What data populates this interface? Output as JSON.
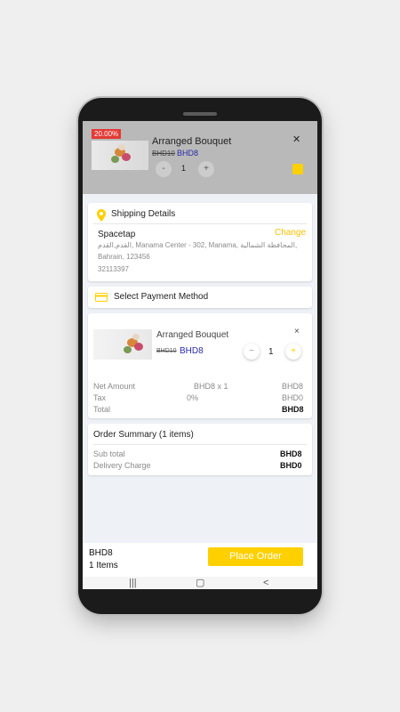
{
  "overlay": {
    "discount_badge": "20.00%",
    "title": "Arranged Bouquet",
    "close": "✕",
    "old_price": "BHD10",
    "new_price": "BHD8",
    "minus": "-",
    "qty": "1",
    "plus": "+"
  },
  "shipping": {
    "title": "Shipping Details",
    "name": "Spacetap",
    "change": "Change",
    "address_line1": "القدم,القدم, Manama Center  - 302, Manama, المحافظة الشمالية,",
    "address_line2": "Bahrain, 123456",
    "phone": "32113397"
  },
  "payment": {
    "title": "Select Payment Method"
  },
  "cart_item": {
    "title": "Arranged Bouquet",
    "close": "×",
    "old_price": "BHD10",
    "new_price": "BHD8",
    "minus": "−",
    "qty": "1",
    "plus": "+",
    "rows": [
      {
        "label": "Net Amount",
        "mid": "BHD8 x 1",
        "value": "BHD8"
      },
      {
        "label": "Tax",
        "mid": "0%",
        "value": "BHD0"
      },
      {
        "label": "Total",
        "mid": "",
        "value": "BHD8"
      }
    ]
  },
  "summary": {
    "title": "Order Summary (1 items)",
    "rows": [
      {
        "label": "Sub total",
        "value": "BHD8"
      },
      {
        "label": "Delivery Charge",
        "value": "BHD0"
      }
    ]
  },
  "footer": {
    "total": "BHD8",
    "items": "1 Items",
    "place_order": "Place Order"
  },
  "navbar": {
    "recent": "|||",
    "home": "▢",
    "back": "<"
  },
  "colors": {
    "accent": "#ffd000",
    "price_blue": "#2b2ba8"
  }
}
